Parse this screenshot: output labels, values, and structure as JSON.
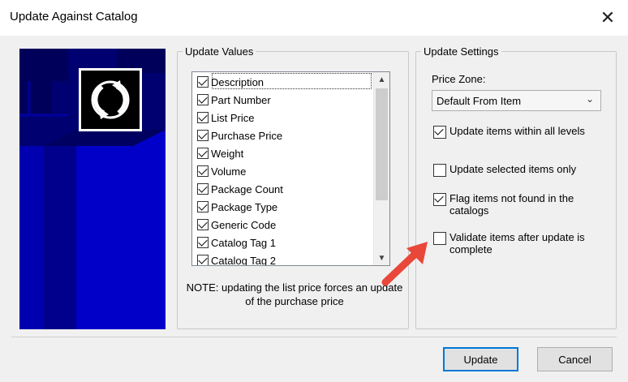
{
  "window": {
    "title": "Update Against Catalog",
    "close_glyph": "✕"
  },
  "update_values": {
    "legend": "Update Values",
    "items": [
      {
        "label": "Description",
        "checked": true
      },
      {
        "label": "Part Number",
        "checked": true
      },
      {
        "label": "List Price",
        "checked": true
      },
      {
        "label": "Purchase Price",
        "checked": true
      },
      {
        "label": "Weight",
        "checked": true
      },
      {
        "label": "Volume",
        "checked": true
      },
      {
        "label": "Package Count",
        "checked": true
      },
      {
        "label": "Package Type",
        "checked": true
      },
      {
        "label": "Generic Code",
        "checked": true
      },
      {
        "label": "Catalog Tag 1",
        "checked": true
      },
      {
        "label": "Catalog Tag 2",
        "checked": true
      }
    ],
    "note": "NOTE: updating the list price forces an update of the purchase price"
  },
  "update_settings": {
    "legend": "Update Settings",
    "price_zone_label": "Price Zone:",
    "price_zone_value": "Default From Item",
    "options": [
      {
        "label": "Update items within all levels",
        "checked": true
      },
      {
        "label": "Update selected items only",
        "checked": false
      },
      {
        "label": "Flag items not found in the catalogs",
        "checked": true
      },
      {
        "label": "Validate items after update is complete",
        "checked": false
      }
    ]
  },
  "buttons": {
    "update": "Update",
    "cancel": "Cancel"
  },
  "colors": {
    "side_panel": "#000070",
    "arrow": "#e8473a",
    "default_button_border": "#0078d7"
  },
  "icons": {
    "logo": "refresh-arrows-icon",
    "annotation": "red-arrow-icon"
  }
}
